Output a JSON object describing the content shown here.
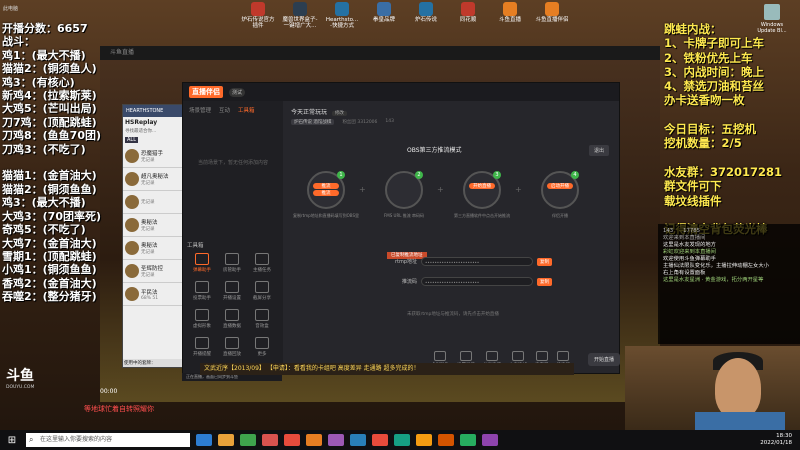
{
  "desktop_icons": [
    {
      "label": "炉石传说官方插件",
      "color": "#c0392b"
    },
    {
      "label": "魔兽世界盒子-一键增广大...",
      "color": "#2c3e50"
    },
    {
      "label": "Hearthsto... -快捷方式",
      "color": "#2471a3"
    },
    {
      "label": "拳皇品牌",
      "color": "#3a6ea5"
    },
    {
      "label": "炉石传说",
      "color": "#2471a3"
    },
    {
      "label": "同花顺",
      "color": "#c0392b"
    },
    {
      "label": "斗鱼直播",
      "color": "#e67e22"
    },
    {
      "label": "斗鱼直播伴侣",
      "color": "#e67e22"
    }
  ],
  "top_left_icons": [
    "此电脑",
    "Tkw8943a1..."
  ],
  "recycle_label": "Windows Update Bl...",
  "overlay_left_lines": [
    "开播分数：6657",
    "战斗：",
    "鸡1：(最大不播)",
    "猫猫2：(铜须鱼人)",
    "鸡3：(有核心)",
    "新鸡4：(拉索斯莱)",
    "大鸡5：(芒叫出局)",
    "刀7鸡：(顶配跳蛙)",
    "刀鸡8：(鱼鱼70团)",
    "刀鸡3：(不吃了)",
    "",
    "猫猫1：(金首油大)",
    "猫猫2：(铜须鱼鱼)",
    "鸡3：(最大不播)",
    "大鸡3：(70团率死)",
    "奇鸡5：(不吃了)",
    "大鸡7：(金首油大)",
    "雪期1：(顶配跳蛙)",
    "小鸡1：(铜须鱼鱼)",
    "香鸡2：(金首油大)",
    "吞噬2：(整分猪牙)"
  ],
  "overlay_right_lines": [
    "跳蛙内战：",
    "1、卡牌子即可上车",
    "2、铁粉优先上车",
    "3、内战时间：晚上",
    "4、禁选刀油和苔丝",
    "办卡送香吻一枚",
    "",
    "今日目标：五挖机",
    "挖机数量：2/5",
    "",
    "水友群：372017281",
    "群文件可下",
    "载坟线插件",
    "",
    "记得清空背包荧光棒"
  ],
  "stream_window_title": "斗鱼直播",
  "hs_panel": {
    "title": "HEARTHSTONE",
    "brand": "HSReplay",
    "brand_sub": "寻找最适合你...",
    "filter_all": "ALL",
    "minions": [
      {
        "name": "恐魔猎手",
        "status": "无记录"
      },
      {
        "name": "超凡奥秘法",
        "status": "无记录"
      },
      {
        "name": "",
        "status": "无记录"
      },
      {
        "name": "奥秘法",
        "status": "无记录"
      },
      {
        "name": "奥秘法",
        "status": "无记录"
      },
      {
        "name": "圣辉防控",
        "status": "无记录"
      },
      {
        "name": "平民法",
        "status": "68% 51"
      }
    ],
    "footer": "使用中的套牌："
  },
  "app": {
    "logo": "直播伴侣",
    "version": "测试",
    "tabs": [
      "场景管理",
      "互动",
      "工具箱"
    ],
    "side_note": "当前场景下，暂无任何添加内容",
    "tools_header": "工具箱",
    "tools": [
      "弹幕助手",
      "房管助手",
      "主播任务",
      "投票助手",
      "开播设置",
      "截屏分享",
      "虚拟形象",
      "直播数据",
      "音效盒",
      "开播提醒",
      "直播回放",
      "更多"
    ],
    "room_title": "今天正常玩玩",
    "room_tag": "修改",
    "room_category": "炉石传说 酒馆战棋",
    "room_hot": "粉丝团 3312006",
    "room_likes": "143",
    "mode_label": "OBS第三方推流模式",
    "back_label": "退出",
    "steps": [
      {
        "num": "1",
        "pills": [
          "推流",
          "推流"
        ],
        "caption": "复制rtmp地址和直播码填写到OBS里"
      },
      {
        "num": "2",
        "pills": [],
        "caption": "FMS URL 推流 串码码"
      },
      {
        "num": "3",
        "pills": [
          "开始直播"
        ],
        "caption": "第三方直播软件中点击开始推流"
      },
      {
        "num": "4",
        "pills": [
          "启动开播"
        ],
        "caption": "伴侣开播"
      }
    ],
    "warn": "已复制推流地址",
    "rtmp_label": "rtmp地址",
    "rtmp_value": "•••••••••••••••••••••••",
    "code_label": "推流码",
    "code_value": "•••••••••••••••••••••••",
    "copy_label": "复制",
    "hint": "未获取rtmp地址与推流码，请先点击开始直播",
    "bottom_buttons": [
      "虚拟形象",
      "设置弹幕",
      "分享直播",
      "上麦连线",
      "麦克风",
      "扬声器"
    ],
    "start_label": "开始直播",
    "status": "正在直播，画面已同步到斗鱼"
  },
  "ticker": "文武近序【2013/09】 【申请】：看看我的卡组吧 高度差异 走通路 超多完成的！",
  "douyu_logo": "斗鱼",
  "douyu_sub": "DOUYU.COM",
  "timestamp": "00:00",
  "bottom_msg": "等地球忙着自转照耀你",
  "chat": {
    "stats": [
      "143",
      "17785"
    ],
    "lines": [
      {
        "cls": "sys",
        "text": "欢迎来到本直播间"
      },
      {
        "cls": "",
        "text": "这里是水友发现的地方"
      },
      {
        "cls": "g",
        "text": "彩虹欢迎来到本直播间"
      },
      {
        "cls": "",
        "text": "欢迎使用斗鱼弹幕助手"
      },
      {
        "cls": "",
        "text": "主播仙法限队变化乐，主播拉伸动棚左女大小"
      },
      {
        "cls": "",
        "text": "右上角有设置面板"
      },
      {
        "cls": "g",
        "text": "这里是水友星洲 · 黄金游戏，拓分两开星等"
      }
    ]
  },
  "taskbar": {
    "search_placeholder": "在这里输入你要搜索的内容",
    "apps": [
      "#2d7dd2",
      "#e8a23a",
      "#3fa34d",
      "#d9534f",
      "#e74c3c",
      "#e67e22",
      "#9b59b6",
      "#2980b9",
      "#e74c3c",
      "#16a085",
      "#f39c12",
      "#d35400",
      "#27ae60",
      "#8e44ad"
    ],
    "time": "18:30",
    "date": "2022/01/18"
  }
}
